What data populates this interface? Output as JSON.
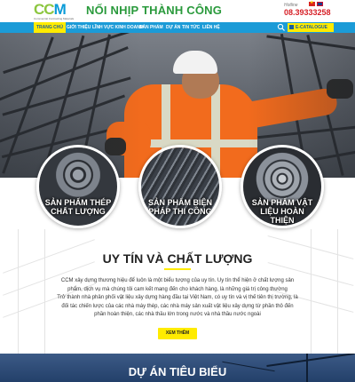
{
  "header": {
    "logo_text": "CCM",
    "logo_sub": "Commercial Contracting Materials",
    "slogan": "NỐI NHỊP THÀNH CÔNG",
    "hotline_label": "Hotline",
    "hotline_number": "08.39333258"
  },
  "nav": {
    "items": [
      "TRANG CHỦ",
      "GIỚI THIỆU",
      "LĨNH VỰC KINH DOANH",
      "SẢN PHẨM",
      "DỰ ÁN",
      "TIN TỨC",
      "LIÊN HỆ"
    ],
    "catalogue_label": "E-CATALOGUE"
  },
  "products": [
    {
      "label": "SẢN PHẨM THÉP CHẤT LƯỢNG"
    },
    {
      "label": "SẢN PHẨM BIỆN PHÁP THI CÔNG"
    },
    {
      "label": "SẢN PHẨM VẬT LIỆU HOÀN THIỆN"
    }
  ],
  "section": {
    "title": "UY TÍN VÀ CHẤT LƯỢNG",
    "paragraph1": "CCM xây dựng thương hiệu để luôn là một biểu tượng của uy tín. Uy tín thể hiện ở chất lượng sản phẩm, dịch vụ mà chúng tôi cam kết mang đến cho khách hàng, là những giá trị công thường",
    "paragraph2": "Trở thành nhà phân phối vật liệu xây dựng hàng đầu tại Việt Nam, có uy tín và vị thế tiên thị trường, là đối tác chiến lược của các nhà máy thép, các nhà máy sản xuất vật liệu xây dựng từ phần thô đến phần hoàn thiện, các nhà thầu lớn trong nước và nhà thầu nước ngoài",
    "more_button": "XEM THÊM"
  },
  "projects": {
    "title": "DỰ ÁN TIÊU BIỂU"
  },
  "colors": {
    "nav": "#1b9bd7",
    "accent_yellow": "#ffeb00",
    "slogan_green": "#2a9a3c",
    "hotline_red": "#d61f26"
  }
}
